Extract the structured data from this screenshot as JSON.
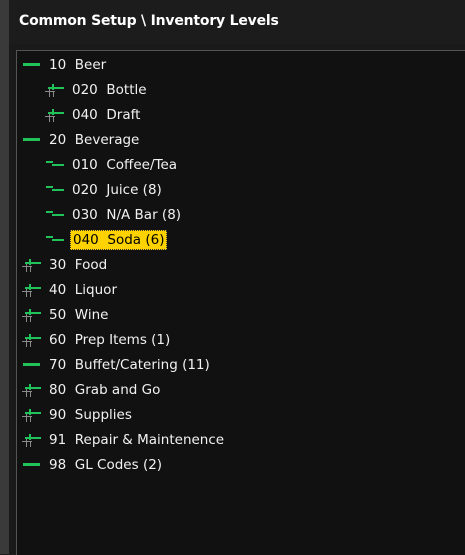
{
  "window": {
    "title": "Common Setup \\ Inventory Levels"
  },
  "colors": {
    "accent_green": "#22c25a",
    "selection": "#fcd200",
    "background": "#111111"
  },
  "tree": {
    "rows": [
      {
        "code": "10",
        "name": "Beer",
        "level": 0,
        "icon": "expanded-node-icon"
      },
      {
        "code": "020",
        "name": "Bottle",
        "level": 1,
        "icon": "collapsed-node-icon"
      },
      {
        "code": "040",
        "name": "Draft",
        "level": 1,
        "icon": "collapsed-node-icon"
      },
      {
        "code": "20",
        "name": "Beverage",
        "level": 0,
        "icon": "expanded-node-icon"
      },
      {
        "code": "010",
        "name": "Coffee/Tea",
        "level": 1,
        "icon": "leaf-node-icon"
      },
      {
        "code": "020",
        "name": "Juice (8)",
        "level": 1,
        "icon": "leaf-node-icon"
      },
      {
        "code": "030",
        "name": "N/A Bar (8)",
        "level": 1,
        "icon": "leaf-node-icon"
      },
      {
        "code": "040",
        "name": "Soda (6)",
        "level": 1,
        "icon": "leaf-node-icon",
        "selected": true
      },
      {
        "code": "30",
        "name": "Food",
        "level": 0,
        "icon": "collapsed-node-icon"
      },
      {
        "code": "40",
        "name": "Liquor",
        "level": 0,
        "icon": "collapsed-node-icon"
      },
      {
        "code": "50",
        "name": "Wine",
        "level": 0,
        "icon": "collapsed-node-icon"
      },
      {
        "code": "60",
        "name": "Prep Items (1)",
        "level": 0,
        "icon": "collapsed-node-icon"
      },
      {
        "code": "70",
        "name": "Buffet/Catering (11)",
        "level": 0,
        "icon": "expanded-node-icon"
      },
      {
        "code": "80",
        "name": "Grab and Go",
        "level": 0,
        "icon": "collapsed-node-icon"
      },
      {
        "code": "90",
        "name": "Supplies",
        "level": 0,
        "icon": "collapsed-node-icon"
      },
      {
        "code": "91",
        "name": "Repair & Maintenence",
        "level": 0,
        "icon": "collapsed-node-icon"
      },
      {
        "code": "98",
        "name": "GL Codes (2)",
        "level": 0,
        "icon": "expanded-node-icon"
      }
    ]
  }
}
